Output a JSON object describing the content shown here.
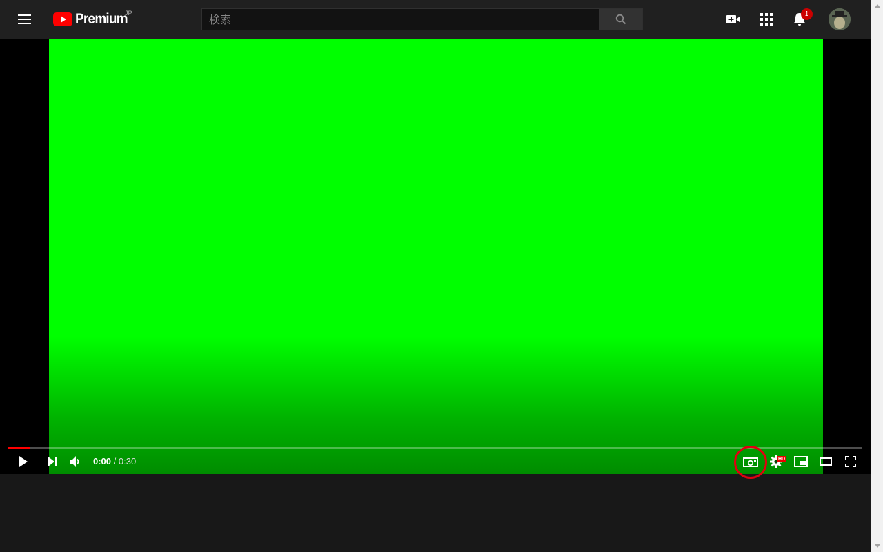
{
  "header": {
    "logo_text": "Premium",
    "logo_country": "JP",
    "search_placeholder": "検索",
    "notification_count": "1",
    "icons": [
      "menu-icon",
      "youtube-logo-icon",
      "search-icon",
      "create-video-icon",
      "apps-icon",
      "bell-icon",
      "avatar"
    ]
  },
  "player": {
    "time_current": "0:00",
    "time_separator": " / ",
    "time_duration": "0:30",
    "progress_fraction": 0.026,
    "video_color": "#00ff00",
    "controls": [
      "play-icon",
      "next-icon",
      "volume-icon",
      "screenshot-camera-icon",
      "settings-icon",
      "miniplayer-icon",
      "theater-mode-icon",
      "fullscreen-icon"
    ],
    "settings_badge": "HD",
    "highlight_color": "#e00010"
  }
}
